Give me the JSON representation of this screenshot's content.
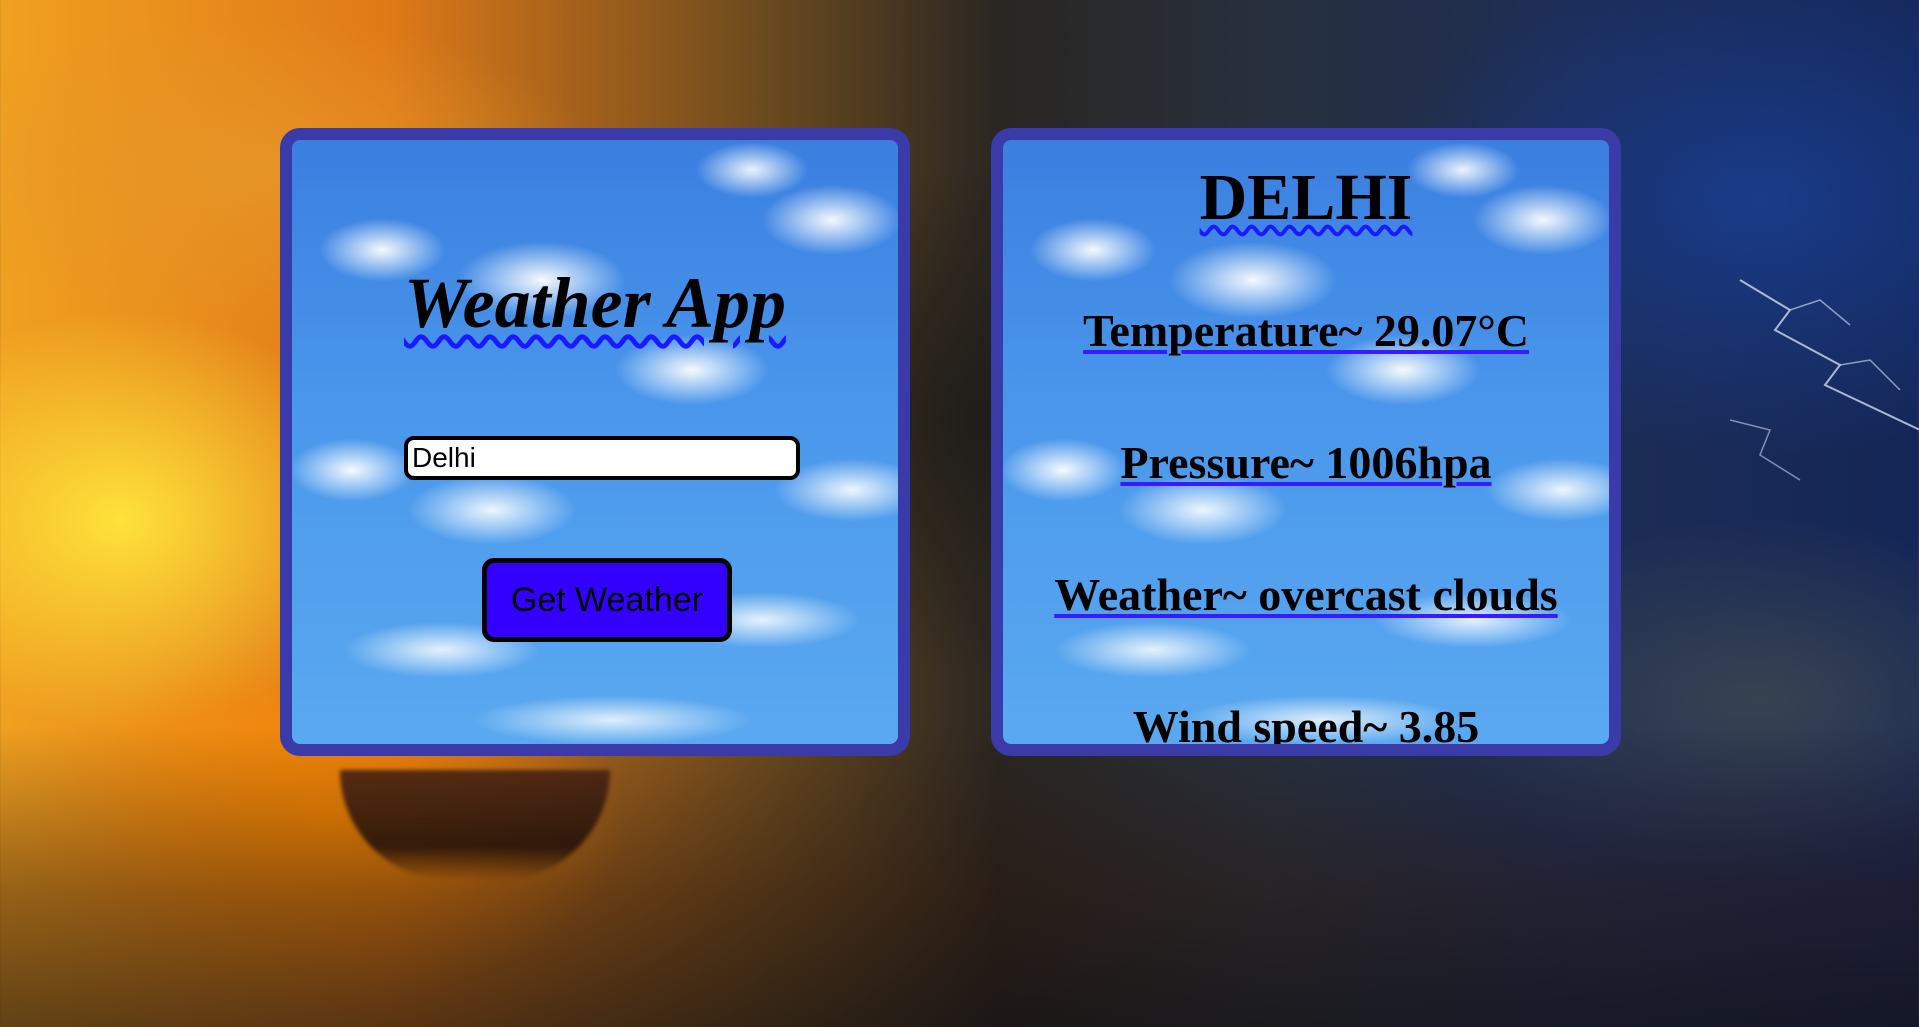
{
  "app": {
    "title": "Weather App"
  },
  "search": {
    "value": "Delhi",
    "button_label": "Get Weather"
  },
  "result": {
    "city": "DELHI",
    "temperature": "Temperature~ 29.07°C",
    "pressure": "Pressure~ 1006hpa",
    "weather": "Weather~ overcast clouds",
    "wind_speed": "Wind speed~ 3.85"
  },
  "colors": {
    "card_border": "#3a3aa8",
    "button_bg": "#3300ff",
    "underline": "#1a1aff"
  }
}
